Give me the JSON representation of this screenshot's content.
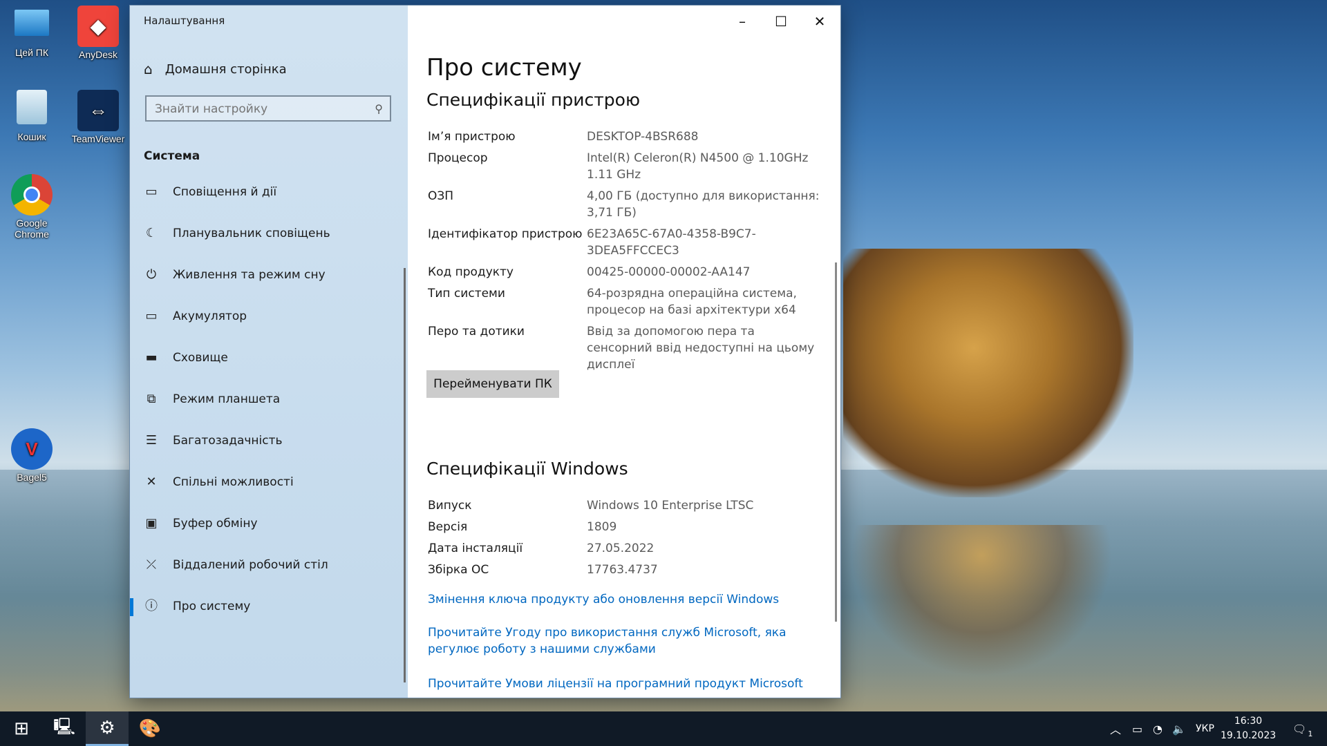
{
  "desktop": {
    "icons": [
      {
        "label": "Цей ПК"
      },
      {
        "label": "AnyDesk"
      },
      {
        "label": "Кошик"
      },
      {
        "label": "TeamViewer"
      },
      {
        "label": "Google Chrome"
      },
      {
        "label": "Bagel5"
      }
    ]
  },
  "window": {
    "title": "Налаштування",
    "controls": {
      "minimize": "–",
      "maximize": "☐",
      "close": "✕"
    }
  },
  "sidebar": {
    "home_label": "Домашня сторінка",
    "search_placeholder": "Знайти настройку",
    "section_title": "Система",
    "items": [
      {
        "label": "Сповіщення й дії",
        "icon": "message-icon"
      },
      {
        "label": "Планувальник сповіщень",
        "icon": "moon-icon"
      },
      {
        "label": "Живлення та режим сну",
        "icon": "power-icon"
      },
      {
        "label": "Акумулятор",
        "icon": "battery-icon"
      },
      {
        "label": "Сховище",
        "icon": "storage-icon"
      },
      {
        "label": "Режим планшета",
        "icon": "tablet-icon"
      },
      {
        "label": "Багатозадачність",
        "icon": "multitask-icon"
      },
      {
        "label": "Спільні можливості",
        "icon": "shared-icon"
      },
      {
        "label": "Буфер обміну",
        "icon": "clipboard-icon"
      },
      {
        "label": "Віддалений робочий стіл",
        "icon": "remote-icon"
      },
      {
        "label": "Про систему",
        "icon": "info-icon",
        "active": true
      }
    ]
  },
  "main": {
    "title": "Про систему",
    "device_specs": {
      "heading": "Специфікації пристрою",
      "rows": [
        {
          "key": "Ім’я пристрою",
          "value": "DESKTOP-4BSR688"
        },
        {
          "key": "Процесор",
          "value": "Intel(R) Celeron(R) N4500 @ 1.10GHz   1.11 GHz"
        },
        {
          "key": "ОЗП",
          "value": "4,00 ГБ (доступно для використання: 3,71 ГБ)"
        },
        {
          "key": "Ідентифікатор пристрою",
          "value": "6E23A65C-67A0-4358-B9C7-3DEA5FFCCEC3"
        },
        {
          "key": "Код продукту",
          "value": "00425-00000-00002-AA147"
        },
        {
          "key": "Тип системи",
          "value": "64-розрядна операційна система, процесор на базі архітектури x64"
        },
        {
          "key": "Перо та дотики",
          "value": "Ввід за допомогою пера та сенсорний ввід недоступні на цьому дисплеї"
        }
      ],
      "rename_button": "Перейменувати ПК"
    },
    "windows_specs": {
      "heading": "Специфікації Windows",
      "rows": [
        {
          "key": "Випуск",
          "value": "Windows 10 Enterprise LTSC"
        },
        {
          "key": "Версія",
          "value": "1809"
        },
        {
          "key": "Дата інсталяції",
          "value": "27.05.2022"
        },
        {
          "key": "Збірка ОС",
          "value": "17763.4737"
        }
      ]
    },
    "links": [
      "Змінення ключа продукту або оновлення версії Windows",
      "Прочитайте Угоду про використання служб Microsoft, яка регулює роботу з нашими службами",
      "Прочитайте Умови ліцензії на програмний продукт Microsoft"
    ]
  },
  "taskbar": {
    "language": "УКР",
    "time": "16:30",
    "date": "19.10.2023",
    "notification_count": "1"
  }
}
